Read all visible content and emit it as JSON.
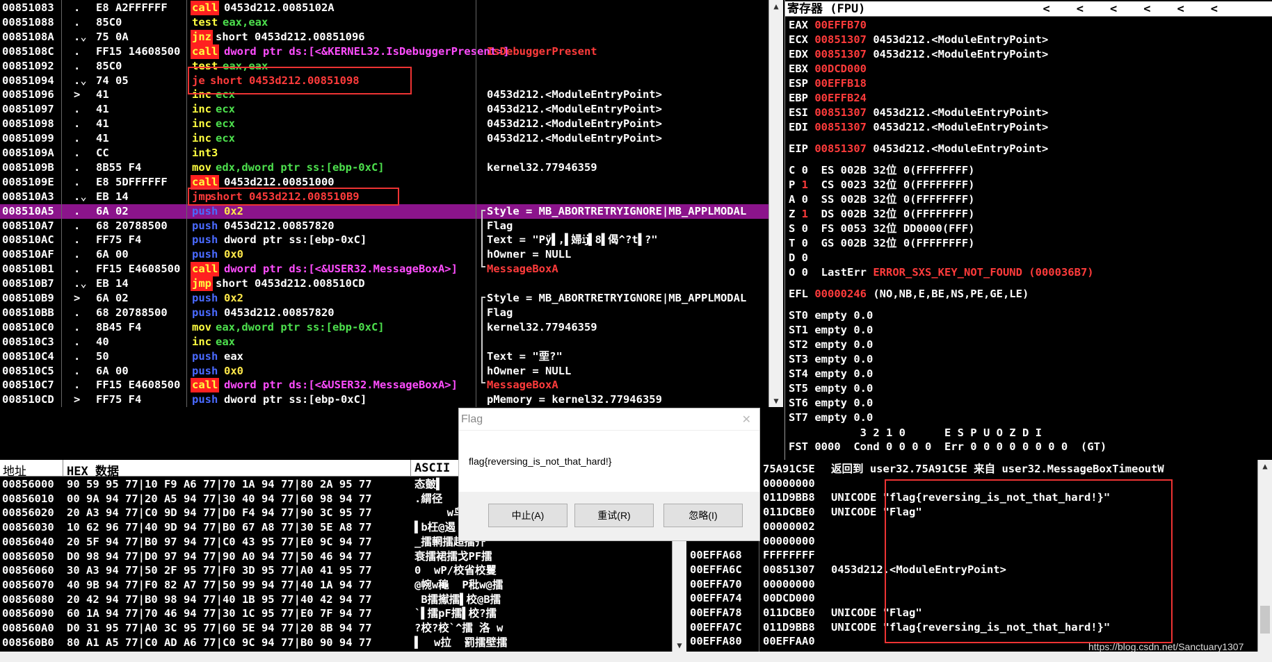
{
  "disasm": [
    {
      "addr": "00851083",
      "mark": ".",
      "bytes": "E8 A2FFFFFF",
      "mn": "call",
      "mncls": "call",
      "ops": "0453d212.0085102A",
      "note": ""
    },
    {
      "addr": "00851088",
      "mark": ".",
      "bytes": "85C0",
      "mn": "test",
      "mncls": "test",
      "ops": "eax,eax",
      "note": ""
    },
    {
      "addr": "0085108A",
      "mark": ".⌄",
      "bytes": "75 0A",
      "mn": "jnz",
      "mncls": "jnz",
      "ops": "short 0453d212.00851096",
      "note": ""
    },
    {
      "addr": "0085108C",
      "mark": ".",
      "bytes": "FF15 14608500",
      "mn": "call",
      "mncls": "call",
      "ops": "dword ptr ds:[<&KERNEL32.IsDebuggerPresent>]",
      "note": "IsDebuggerPresent"
    },
    {
      "addr": "00851092",
      "mark": ".",
      "bytes": "85C0",
      "mn": "test",
      "mncls": "test",
      "ops": "eax,eax",
      "note": ""
    },
    {
      "addr": "00851094",
      "mark": ".⌄",
      "bytes": "74 05",
      "mn": "je",
      "mncls": "je",
      "ops": "short 0453d212.00851098",
      "note": ""
    },
    {
      "addr": "00851096",
      "mark": ">",
      "bytes": "41",
      "mn": "inc",
      "mncls": "inc",
      "ops": "ecx",
      "note": "0453d212.<ModuleEntryPoint>"
    },
    {
      "addr": "00851097",
      "mark": ".",
      "bytes": "41",
      "mn": "inc",
      "mncls": "inc",
      "ops": "ecx",
      "note": "0453d212.<ModuleEntryPoint>"
    },
    {
      "addr": "00851098",
      "mark": ".",
      "bytes": "41",
      "mn": "inc",
      "mncls": "inc",
      "ops": "ecx",
      "note": "0453d212.<ModuleEntryPoint>"
    },
    {
      "addr": "00851099",
      "mark": ".",
      "bytes": "41",
      "mn": "inc",
      "mncls": "inc",
      "ops": "ecx",
      "note": "0453d212.<ModuleEntryPoint>"
    },
    {
      "addr": "0085109A",
      "mark": ".",
      "bytes": "CC",
      "mn": "int3",
      "mncls": "int",
      "ops": "",
      "note": ""
    },
    {
      "addr": "0085109B",
      "mark": ".",
      "bytes": "8B55 F4",
      "mn": "mov",
      "mncls": "mov",
      "ops": "edx,dword ptr ss:[ebp-0xC]",
      "note": "kernel32.77946359"
    },
    {
      "addr": "0085109E",
      "mark": ".",
      "bytes": "E8 5DFFFFFF",
      "mn": "call",
      "mncls": "call",
      "ops": "0453d212.00851000",
      "note": ""
    },
    {
      "addr": "008510A3",
      "mark": ".⌄",
      "bytes": "EB 14",
      "mn": "jmp",
      "mncls": "je",
      "ops": "short 0453d212.008510B9",
      "note": ""
    },
    {
      "addr": "008510A5",
      "mark": ".",
      "bytes": "6A 02",
      "mn": "push",
      "mncls": "push",
      "ops": "0x2",
      "note": "Style = MB_ABORTRETRYIGNORE|MB_APPLMODAL"
    },
    {
      "addr": "008510A7",
      "mark": ".",
      "bytes": "68 20788500",
      "mn": "push",
      "mncls": "push",
      "ops": "0453d212.00857820",
      "note": "Flag"
    },
    {
      "addr": "008510AC",
      "mark": ".",
      "bytes": "FF75 F4",
      "mn": "push",
      "mncls": "push",
      "ops": "dword ptr ss:[ebp-0xC]",
      "note": "Text = \"Pÿ▌,▌婦ĳ▌8▌偈^?t▌?\""
    },
    {
      "addr": "008510AF",
      "mark": ".",
      "bytes": "6A 00",
      "mn": "push",
      "mncls": "push",
      "ops": "0x0",
      "note": "hOwner = NULL"
    },
    {
      "addr": "008510B1",
      "mark": ".",
      "bytes": "FF15 E4608500",
      "mn": "call",
      "mncls": "call",
      "ops": "dword ptr ds:[<&USER32.MessageBoxA>]",
      "note": "MessageBoxA"
    },
    {
      "addr": "008510B7",
      "mark": ".⌄",
      "bytes": "EB 14",
      "mn": "jmp",
      "mncls": "jmp",
      "ops": "short 0453d212.008510CD",
      "note": ""
    },
    {
      "addr": "008510B9",
      "mark": ">",
      "bytes": "6A 02",
      "mn": "push",
      "mncls": "push",
      "ops": "0x2",
      "note": "Style = MB_ABORTRETRYIGNORE|MB_APPLMODAL"
    },
    {
      "addr": "008510BB",
      "mark": ".",
      "bytes": "68 20788500",
      "mn": "push",
      "mncls": "push",
      "ops": "0453d212.00857820",
      "note": "Flag"
    },
    {
      "addr": "008510C0",
      "mark": ".",
      "bytes": "8B45 F4",
      "mn": "mov",
      "mncls": "mov",
      "ops": "eax,dword ptr ss:[ebp-0xC]",
      "note": "kernel32.77946359"
    },
    {
      "addr": "008510C3",
      "mark": ".",
      "bytes": "40",
      "mn": "inc",
      "mncls": "inc",
      "ops": "eax",
      "note": ""
    },
    {
      "addr": "008510C4",
      "mark": ".",
      "bytes": "50",
      "mn": "push",
      "mncls": "push",
      "ops": "eax",
      "note": "Text = \"垔?\""
    },
    {
      "addr": "008510C5",
      "mark": ".",
      "bytes": "6A 00",
      "mn": "push",
      "mncls": "push",
      "ops": "0x0",
      "note": "hOwner = NULL"
    },
    {
      "addr": "008510C7",
      "mark": ".",
      "bytes": "FF15 E4608500",
      "mn": "call",
      "mncls": "call",
      "ops": "dword ptr ds:[<&USER32.MessageBoxA>]",
      "note": "MessageBoxA"
    },
    {
      "addr": "008510CD",
      "mark": ">",
      "bytes": "FF75 F4",
      "mn": "push",
      "mncls": "push",
      "ops": "dword ptr ss:[ebp-0xC]",
      "note": "pMemory = kernel32.77946359"
    }
  ],
  "registers": {
    "header": "寄存器 (FPU)",
    "nav": [
      "<",
      "<",
      "<",
      "<",
      "<",
      "<"
    ],
    "gp": [
      {
        "name": "EAX",
        "val": "00EFFB70",
        "comment": ""
      },
      {
        "name": "ECX",
        "val": "00851307",
        "comment": "0453d212.<ModuleEntryPoint>"
      },
      {
        "name": "EDX",
        "val": "00851307",
        "comment": "0453d212.<ModuleEntryPoint>"
      },
      {
        "name": "EBX",
        "val": "00DCD000",
        "comment": ""
      },
      {
        "name": "ESP",
        "val": "00EFFB18",
        "comment": ""
      },
      {
        "name": "EBP",
        "val": "00EFFB24",
        "comment": ""
      },
      {
        "name": "ESI",
        "val": "00851307",
        "comment": "0453d212.<ModuleEntryPoint>"
      },
      {
        "name": "EDI",
        "val": "00851307",
        "comment": "0453d212.<ModuleEntryPoint>"
      }
    ],
    "eip": {
      "name": "EIP",
      "val": "00851307",
      "comment": "0453d212.<ModuleEntryPoint>"
    },
    "flags": [
      {
        "f": "C",
        "v": "0",
        "seg": "ES",
        "sv": "002B",
        "bits": "32位",
        "desc": "0(FFFFFFFF)"
      },
      {
        "f": "P",
        "v": "1",
        "seg": "CS",
        "sv": "0023",
        "bits": "32位",
        "desc": "0(FFFFFFFF)"
      },
      {
        "f": "A",
        "v": "0",
        "seg": "SS",
        "sv": "002B",
        "bits": "32位",
        "desc": "0(FFFFFFFF)"
      },
      {
        "f": "Z",
        "v": "1",
        "seg": "DS",
        "sv": "002B",
        "bits": "32位",
        "desc": "0(FFFFFFFF)"
      },
      {
        "f": "S",
        "v": "0",
        "seg": "FS",
        "sv": "0053",
        "bits": "32位",
        "desc": "DD0000(FFF)"
      },
      {
        "f": "T",
        "v": "0",
        "seg": "GS",
        "sv": "002B",
        "bits": "32位",
        "desc": "0(FFFFFFFF)"
      },
      {
        "f": "D",
        "v": "0",
        "seg": "",
        "sv": "",
        "bits": "",
        "desc": ""
      },
      {
        "f": "O",
        "v": "0",
        "seg": "LastErr",
        "sv": "",
        "bits": "",
        "desc": "ERROR_SXS_KEY_NOT_FOUND (000036B7)"
      }
    ],
    "efl": {
      "name": "EFL",
      "val": "00000246",
      "desc": "(NO,NB,E,BE,NS,PE,GE,LE)"
    },
    "st": [
      "ST0 empty 0.0",
      "ST1 empty 0.0",
      "ST2 empty 0.0",
      "ST3 empty 0.0",
      "ST4 empty 0.0",
      "ST5 empty 0.0",
      "ST6 empty 0.0",
      "ST7 empty 0.0"
    ],
    "fst_hdr": "           3 2 1 0      E S P U O Z D I",
    "fst": "FST 0000  Cond 0 0 0 0  Err 0 0 0 0 0 0 0 0  (GT)"
  },
  "dump": {
    "col_addr": "地址",
    "col_hex": "HEX 数据",
    "col_ascii": "ASCII",
    "rows": [
      {
        "a": "00856000",
        "h": "90 59 95 77|10 F9 A6 77|70 1A 94 77|80 2A 95 77",
        "s": "态皼▌"
      },
      {
        "a": "00856010",
        "h": "00 9A 94 77|20 A5 94 77|30 40 94 77|60 98 94 77",
        "s": ".緭径"
      },
      {
        "a": "00856020",
        "h": "20 A3 94 77|C0 9D 94 77|D0 F4 94 77|90 3C 95 77",
        "s": "     w鸟"
      },
      {
        "a": "00856030",
        "h": "10 62 96 77|40 9D 94 77|B0 67 A8 77|30 5E A8 77",
        "s": "▌b枉@遏"
      },
      {
        "a": "00856040",
        "h": "20 5F 94 77|B0 97 94 77|C0 43 95 77|E0 9C 94 77",
        "s": "_擂輞擂超擂齐"
      },
      {
        "a": "00856050",
        "h": "D0 98 94 77|D0 97 94 77|90 A0 94 77|50 46 94 77",
        "s": "衰擂裙擂戈PF擂"
      },
      {
        "a": "00856060",
        "h": "30 A3 94 77|50 2F 95 77|F0 3D 95 77|A0 41 95 77",
        "s": "0  wP/校省校矍"
      },
      {
        "a": "00856070",
        "h": "40 9B 94 77|F0 82 A7 77|50 99 94 77|40 1A 94 77",
        "s": "@帵w龝  P秕w@擂"
      },
      {
        "a": "00856080",
        "h": "20 42 94 77|B0 98 94 77|40 1B 95 77|40 42 94 77",
        "s": " B擂擜擂▌校@B擂"
      },
      {
        "a": "00856090",
        "h": "60 1A 94 77|70 46 94 77|30 1C 95 77|E0 7F 94 77",
        "s": "`▌擂pF擂▌校?擂"
      },
      {
        "a": "008560A0",
        "h": "D0 31 95 77|A0 3C 95 77|60 5E 94 77|20 8B 94 77",
        "s": "?校?校`^擂 洛 w"
      },
      {
        "a": "008560B0",
        "h": "80 A1 A5 77|C0 AD A6 77|C0 9C 94 77|B0 90 94 77",
        "s": "▌  w拉  罰擂壁擂"
      }
    ]
  },
  "stack": {
    "rows": [
      {
        "a": "75A91C5E",
        "v": "返回到 user32.75A91C5E 来自 user32.MessageBoxTimeoutW",
        "c": ""
      },
      {
        "a": "00000000",
        "v": "",
        "c": ""
      },
      {
        "a": "011D9BB8",
        "v": "UNICODE \"flag{reversing_is_not_that_hard!}\"",
        "c": ""
      },
      {
        "a": "011DCBE0",
        "v": "UNICODE \"Flag\"",
        "c": ""
      },
      {
        "a": "00000002",
        "v": "",
        "c": ""
      },
      {
        "a": "00000000",
        "v": "",
        "c": ""
      },
      {
        "a": "FFFFFFFF",
        "v": "",
        "c": ""
      },
      {
        "a": "00851307",
        "v": "0453d212.<ModuleEntryPoint>",
        "c": ""
      },
      {
        "a": "00000000",
        "v": "",
        "c": ""
      },
      {
        "a": "00DCD000",
        "v": "",
        "c": ""
      },
      {
        "a": "011DCBE0",
        "v": "UNICODE \"Flag\"",
        "c": ""
      },
      {
        "a": "011D9BB8",
        "v": "UNICODE \"flag{reversing_is_not_that_hard!}\"",
        "c": ""
      },
      {
        "a": "00EFFAA0",
        "v": "",
        "c": ""
      }
    ],
    "addrs": [
      "",
      "",
      "",
      "",
      "",
      "",
      "00EFFA68",
      "00EFFA6C",
      "00EFFA70",
      "00EFFA74",
      "00EFFA78",
      "00EFFA7C",
      "00EFFA80"
    ]
  },
  "dialog": {
    "title": "Flag",
    "message": "flag{reversing_is_not_that_hard!}",
    "btn_abort": "中止(A)",
    "btn_retry": "重试(R)",
    "btn_ignore": "忽略(I)",
    "close": "✕"
  },
  "watermark": "https://blog.csdn.net/Sanctuary1307"
}
